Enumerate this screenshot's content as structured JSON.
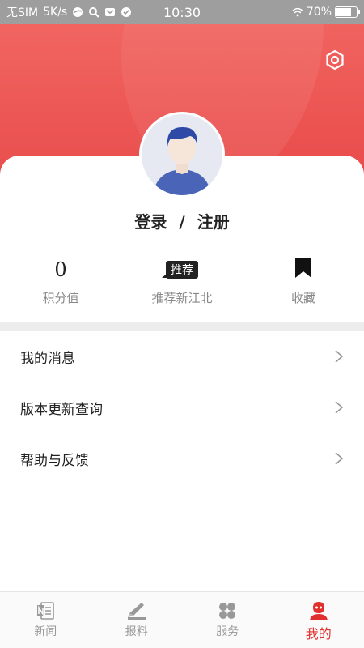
{
  "status_bar": {
    "carrier": "无SIM",
    "speed": "5K/s",
    "time": "10:30",
    "battery": "70%",
    "battery_level": 0.7
  },
  "colors": {
    "brand_red": "#e53a3a",
    "active_tab": "#e0312f"
  },
  "header": {
    "settings_icon": "gear-icon",
    "avatar_icon": "user-avatar-icon"
  },
  "login": {
    "login_label": "登录",
    "separator": "/",
    "register_label": "注册"
  },
  "stats": {
    "points_value": "0",
    "points_label": "积分值",
    "recommend_tag": "推荐",
    "recommend_label": "推荐新江北",
    "favorites_label": "收藏",
    "favorites_icon": "bookmark-icon"
  },
  "menu": {
    "items": [
      {
        "label": "我的消息",
        "icon": "chevron-right-icon"
      },
      {
        "label": "版本更新查询",
        "icon": "chevron-right-icon"
      },
      {
        "label": "帮助与反馈",
        "icon": "chevron-right-icon"
      }
    ]
  },
  "tabbar": {
    "tabs": [
      {
        "label": "新闻",
        "icon": "news-icon",
        "active": false
      },
      {
        "label": "报料",
        "icon": "report-icon",
        "active": false
      },
      {
        "label": "服务",
        "icon": "services-icon",
        "active": false
      },
      {
        "label": "我的",
        "icon": "profile-icon",
        "active": true
      }
    ]
  }
}
